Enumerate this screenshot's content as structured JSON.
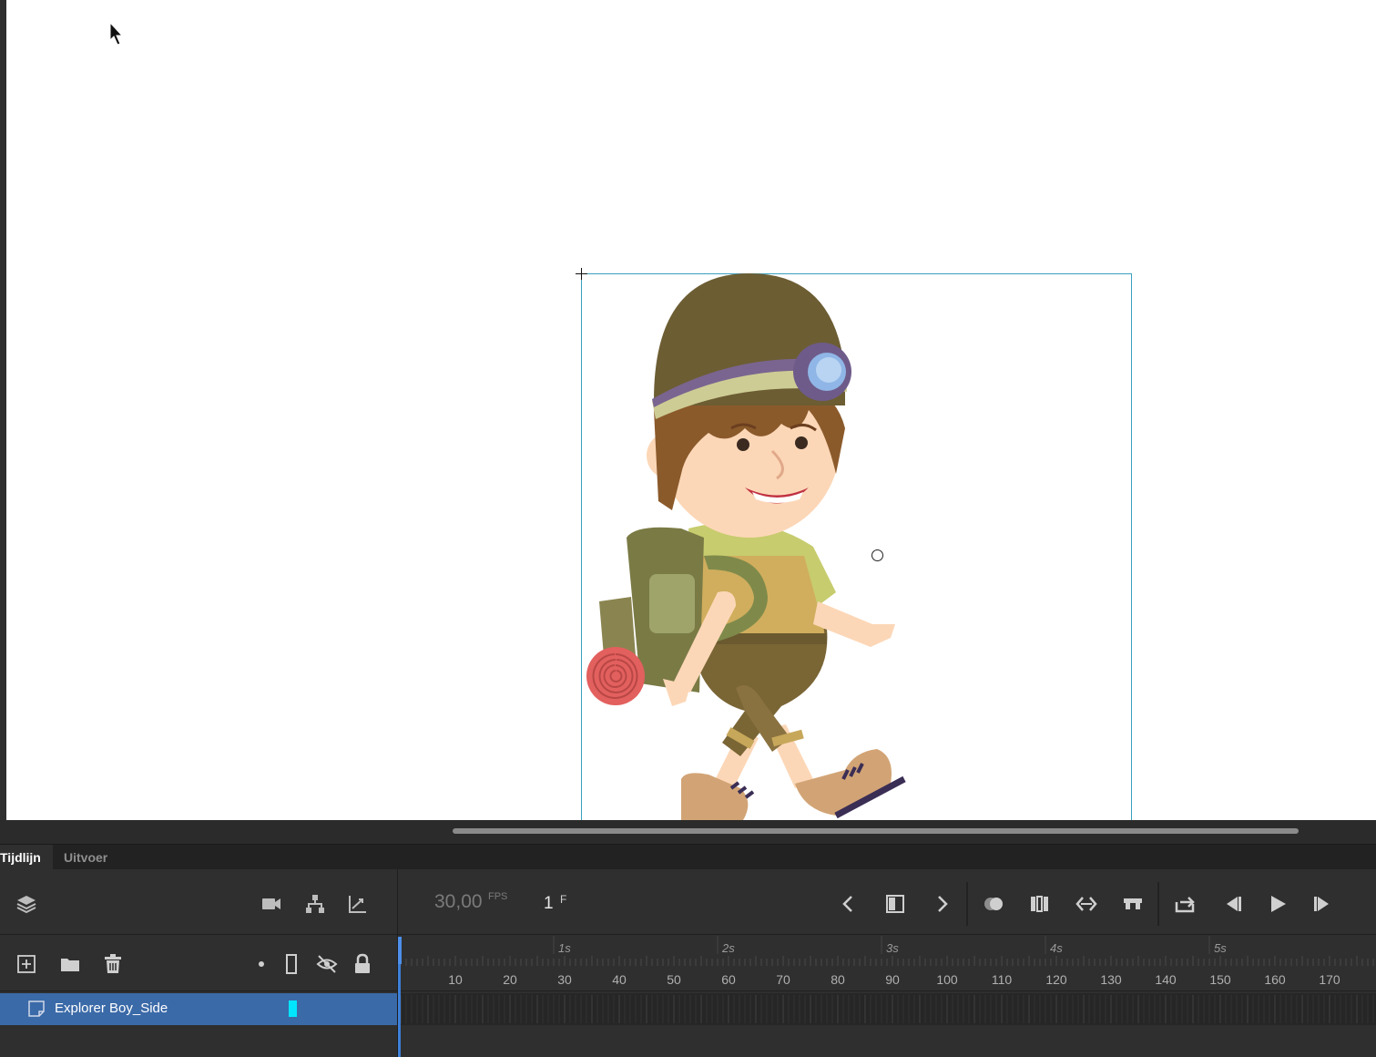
{
  "tabs": {
    "timeline": "Tijdlijn",
    "output": "Uitvoer"
  },
  "toolbar": {
    "fps_value": "30,00",
    "fps_unit": "FPS",
    "frame_value": "1",
    "frame_unit": "F"
  },
  "ruler": {
    "seconds": [
      "1s",
      "2s",
      "3s",
      "4s",
      "5s"
    ],
    "frames": [
      "10",
      "20",
      "30",
      "40",
      "50",
      "60",
      "70",
      "80",
      "90",
      "100",
      "110",
      "120",
      "130",
      "140",
      "150",
      "160",
      "170"
    ]
  },
  "layers": [
    {
      "name": "Explorer Boy_Side",
      "color": "#00e5ff"
    }
  ],
  "icons": {
    "toolbar_left": [
      "layers-icon",
      "camera-icon",
      "layer-parenting-icon",
      "graph-icon"
    ],
    "toolbar_right": [
      "prev-frame-icon",
      "insert-keyframe-icon",
      "next-frame-icon",
      "onion-skin-icon",
      "edit-multiple-frames-icon",
      "swap-icon",
      "center-frame-icon",
      "loop-icon",
      "step-back-icon",
      "play-icon",
      "step-forward-icon"
    ],
    "layer_controls": [
      "new-layer-icon",
      "new-folder-icon",
      "delete-icon",
      "highlight-dot-icon",
      "outline-icon",
      "visibility-icon",
      "lock-icon"
    ]
  },
  "colors": {
    "selection": "#3b6aa8",
    "playhead": "#3d7fd9",
    "layer_color": "#00e5ff"
  }
}
